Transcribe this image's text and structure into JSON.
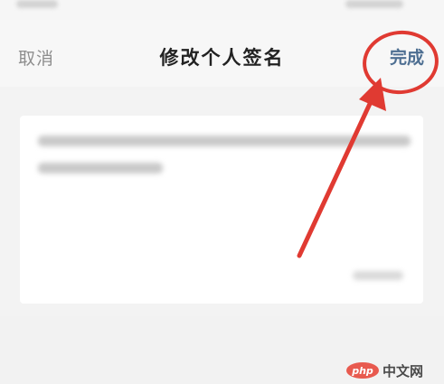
{
  "header": {
    "cancel_label": "取消",
    "title": "修改个人签名",
    "done_label": "完成"
  },
  "annotation": {
    "color": "#e03a32"
  },
  "watermark": {
    "logo_text": "php",
    "text": "中文网"
  },
  "colors": {
    "accent": "#4e6f92",
    "background": "#f3f3f3",
    "card": "#ffffff"
  }
}
